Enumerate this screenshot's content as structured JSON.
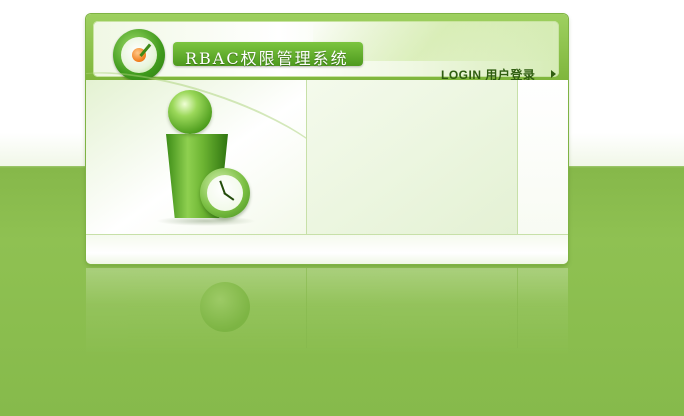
{
  "app": {
    "title": "RBAC权限管理系统"
  },
  "header": {
    "login_label": "LOGIN 用户登录",
    "logo_icon": "clock-logo-icon",
    "arrow_icon": "play-arrow-icon"
  },
  "illustration": {
    "icon": "user-figure-icon",
    "clock_icon": "clock-icon"
  },
  "colors": {
    "accent": "#5aa824",
    "brand_dark": "#2f5d10",
    "background_green": "#8fc152"
  }
}
